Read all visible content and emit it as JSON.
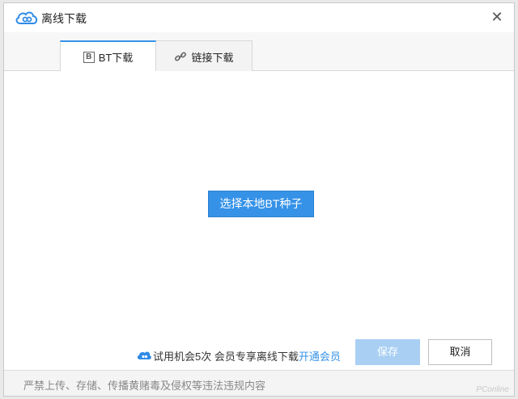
{
  "window": {
    "title": "离线下载",
    "close_symbol": "✕",
    "logo_icon": "cloud-logo-icon"
  },
  "tabs": [
    {
      "label": "BT下载",
      "icon": "bt-icon",
      "active": true
    },
    {
      "label": "链接下载",
      "icon": "link-icon",
      "active": false
    }
  ],
  "main": {
    "select_button_label": "选择本地BT种子"
  },
  "trial": {
    "text": "试用机会5次 会员专享离线下载",
    "link_label": "开通会员"
  },
  "actions": {
    "save_label": "保存",
    "cancel_label": "取消"
  },
  "footer": {
    "notice": "严禁上传、存储、传播黄赌毒及侵权等违法违规内容",
    "watermark": "PConline"
  },
  "colors": {
    "accent": "#3592e7",
    "save_disabled": "#a9cff3"
  }
}
